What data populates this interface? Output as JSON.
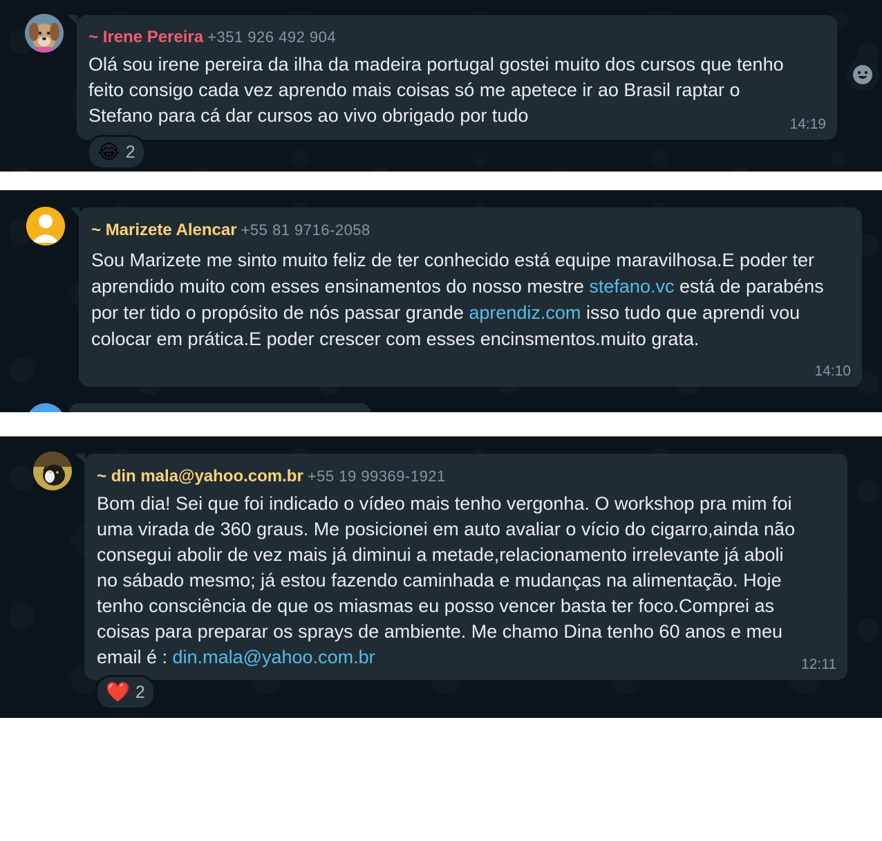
{
  "messages": [
    {
      "sender_prefix": "~ ",
      "sender_name": "Irene Pereira",
      "sender_phone": "+351 926 492 904",
      "name_color": "#f15c6d",
      "text_lines": [
        "Olá  sou irene pereira da ilha da madeira portugal gostei muito dos cursos que tenho",
        "feito consigo  cada vez aprendo mais coisas só  me apetece ir ao Brasil  raptar o",
        "Stefano  para cá  dar cursos ao vivo obrigado por tudo"
      ],
      "time": "14:19",
      "reaction": {
        "emoji": "😂",
        "count": "2"
      },
      "avatar_icon": "dog-photo-avatar"
    },
    {
      "sender_prefix": "~ ",
      "sender_name": "Marizete Alencar",
      "sender_phone": "+55 81 9716-2058",
      "name_color": "#ffd279",
      "text_segments": [
        "Sou Marizete me sinto muito feliz de ter conhecido está equipe maravilhosa.E poder ter aprendido muito com esses ensinamentos do nosso mestre ",
        "stefano.vc",
        " está de parabéns por ter tido o propósito de nós passar grande ",
        "aprendiz.com",
        " isso tudo que aprendi vou colocar em prática.E poder crescer com esses encinsmentos.muito grata."
      ],
      "time": "14:10",
      "avatar_icon": "default-user-avatar"
    },
    {
      "sender_prefix": "~ ",
      "sender_name": "din mala@yahoo.com.br",
      "sender_phone": "+55 19 99369-1921",
      "name_color": "#ffd279",
      "text_lines": [
        "Bom dia! Sei que foi indicado o vídeo mais tenho vergonha. O workshop pra mim foi",
        "uma virada de 360 graus. Me posicionei em auto avaliar o vício do cigarro,ainda não",
        "consegui abolir de vez mais já diminui a metade,relacionamento irrelevante já aboli",
        "no sábado mesmo; já estou fazendo caminhada e mudanças na alimentação. Hoje",
        "tenho consciência de que os miasmas eu posso vencer basta ter foco.Comprei as",
        "coisas para preparar os sprays de ambiente. Me chamo Dina tenho 60 anos e meu"
      ],
      "last_line_prefix": "email é : ",
      "email_link": "din.mala@yahoo.com.br",
      "time": "12:11",
      "reaction": {
        "emoji": "❤️",
        "count": "2"
      },
      "avatar_icon": "cat-photo-avatar"
    }
  ],
  "colors": {
    "chat_background": "#0b141a",
    "bubble": "#202c33",
    "text": "#e9edef",
    "meta": "#8696a0",
    "link": "#53bdeb"
  },
  "icons": {
    "react_button": "smiley-face-icon"
  }
}
